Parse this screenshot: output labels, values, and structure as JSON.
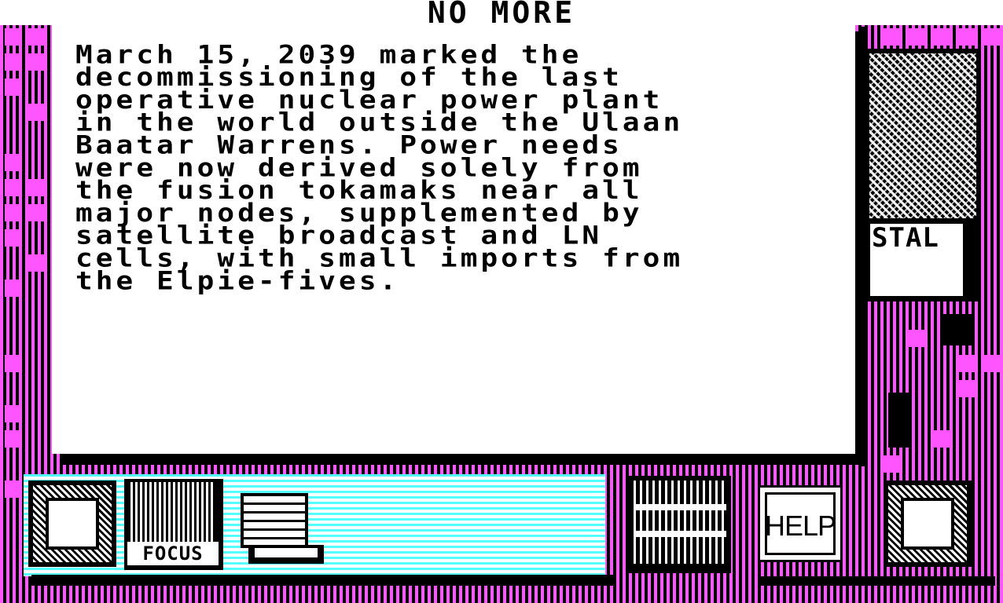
{
  "screen": {
    "title": "NO MORE",
    "story_text": "March 15, 2039 marked the\ndecommissioning of the last\noperative nuclear power plant\nin the world outside the Ulaan\nBaatar Warrens. Power needs\nwere now derived solely from\nthe fusion tokamaks near all\nmajor nodes, supplemented by\nsatellite broadcast and LN\ncells, with small imports from\nthe Elpie-fives."
  },
  "portrait": {
    "icon": "character-portrait-icon",
    "label": "STAL"
  },
  "toolbar": {
    "focus_label": "FOCUS",
    "help_label": "HELP",
    "icons": [
      "left-frame-icon",
      "focus-icon",
      "notepad-icon",
      "door-icon",
      "help-icon",
      "right-frame-icon"
    ]
  },
  "colors": {
    "frame_magenta": "#ff55ff",
    "toolbar_cyan": "#55ffff",
    "text": "#000000",
    "panel": "#ffffff"
  }
}
